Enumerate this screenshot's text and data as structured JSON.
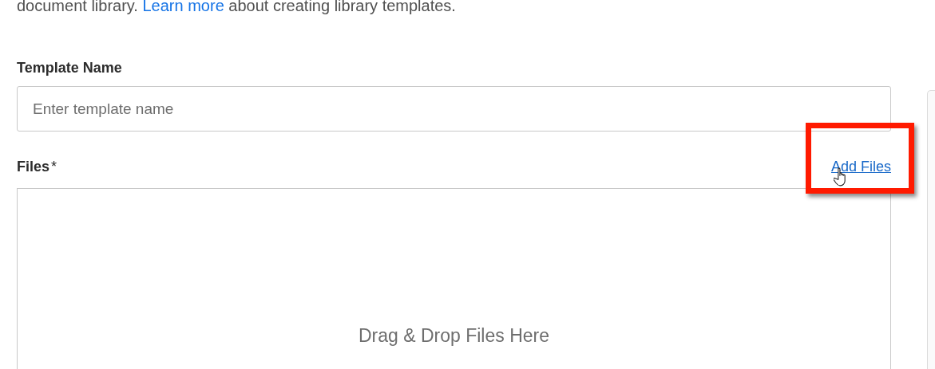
{
  "intro": {
    "before": "document library. ",
    "link": "Learn more",
    "after": " about creating library templates."
  },
  "template_name": {
    "label": "Template Name",
    "placeholder": "Enter template name"
  },
  "files": {
    "label": "Files",
    "required_mark": "*",
    "action": "Add Files",
    "action_highlighted": true,
    "dropzone_text": "Drag & Drop Files Here"
  }
}
